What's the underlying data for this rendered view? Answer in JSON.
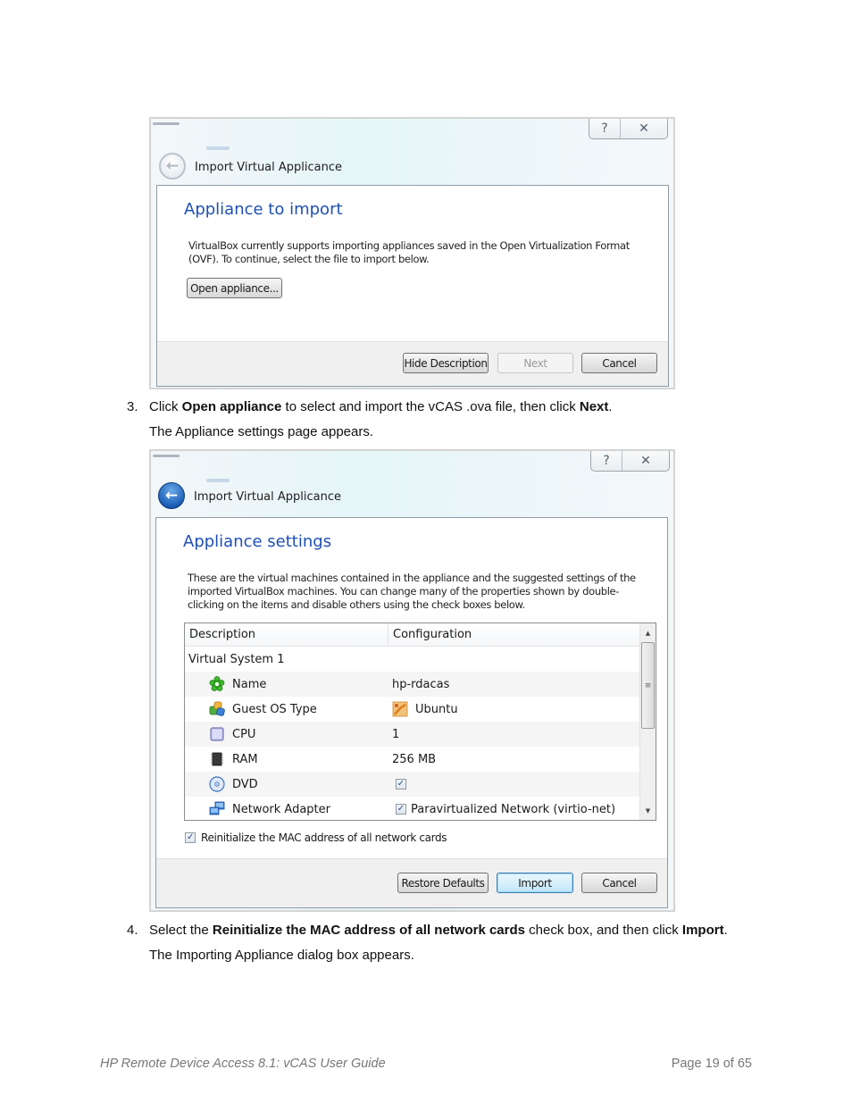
{
  "dialog1": {
    "window_buttons": {
      "help": "?",
      "close": "✕"
    },
    "back_icon": "back-arrow-icon",
    "title": "Import Virtual Applicance",
    "heading": "Appliance to import",
    "description_line1": "VirtualBox currently supports importing appliances saved in the Open Virtualization Format",
    "description_line2": "(OVF). To continue, select the file to import below.",
    "open_button": "Open appliance...",
    "buttons": {
      "hide_description": "Hide Description",
      "next": "Next",
      "cancel": "Cancel"
    }
  },
  "step3": {
    "number": "3.",
    "text_pre": "Click ",
    "bold1": "Open appliance",
    "text_mid": " to select and import the vCAS .ova file, then click ",
    "bold2": "Next",
    "text_end": ".",
    "result": "The Appliance settings page appears."
  },
  "dialog2": {
    "window_buttons": {
      "help": "?",
      "close": "✕"
    },
    "back_icon": "back-arrow-icon",
    "title": "Import Virtual Applicance",
    "heading": "Appliance settings",
    "description_line1": "These are the virtual machines contained in the appliance and the suggested settings of the",
    "description_line2": "imported VirtualBox machines. You can change many of the properties shown by double-",
    "description_line3": "clicking on the items and disable others using the check boxes below.",
    "table": {
      "columns": [
        "Description",
        "Configuration"
      ],
      "group": "Virtual System 1",
      "rows": [
        {
          "icon": "name-star-icon",
          "label": "Name",
          "value": "hp-rdacas"
        },
        {
          "icon": "guest-os-icon",
          "label": "Guest OS Type",
          "value_icon": "ubuntu-os-icon",
          "value": "Ubuntu"
        },
        {
          "icon": "cpu-icon",
          "label": "CPU",
          "value": "1"
        },
        {
          "icon": "ram-icon",
          "label": "RAM",
          "value": "256 MB"
        },
        {
          "icon": "dvd-icon",
          "label": "DVD",
          "checked": true,
          "value": ""
        },
        {
          "icon": "network-adapter-icon",
          "label": "Network Adapter",
          "checked": true,
          "value": "Paravirtualized Network (virtio-net)"
        }
      ]
    },
    "reinit_checkbox": {
      "label": "Reinitialize the MAC address of all network cards",
      "checked": true
    },
    "buttons": {
      "restore_defaults": "Restore Defaults",
      "import": "Import",
      "cancel": "Cancel"
    }
  },
  "step4": {
    "number": "4.",
    "text_pre": "Select the ",
    "bold1": "Reinitialize the MAC address of all network cards",
    "text_mid": " check box, and then click ",
    "bold2": "Import",
    "text_end": ".",
    "result": "The Importing Appliance dialog box appears."
  },
  "footer": {
    "doc_title": "HP Remote Device Access 8.1: vCAS User Guide",
    "page": "Page 19 of 65"
  },
  "colors": {
    "heading_blue": "#1f4fb5",
    "footer_gray": "#777777",
    "default_button": "#bee6fd"
  }
}
